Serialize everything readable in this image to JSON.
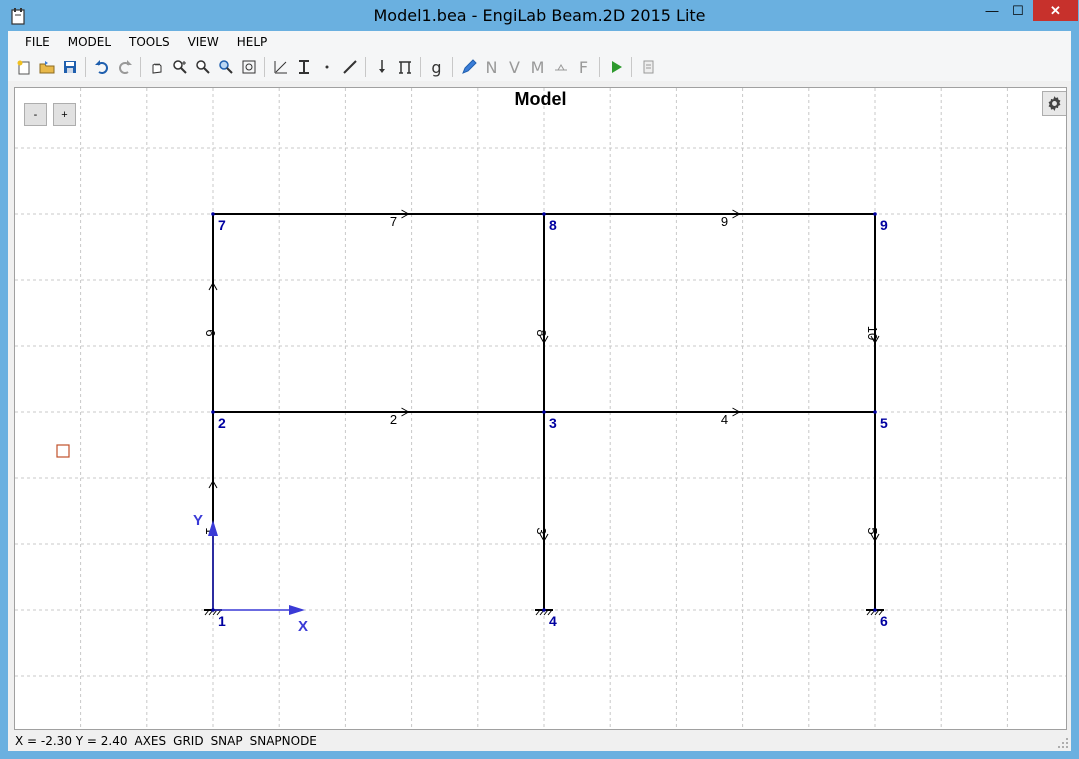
{
  "window": {
    "title": "Model1.bea - EngiLab Beam.2D 2015 Lite",
    "minimize_glyph": "—",
    "maximize_glyph": "☐",
    "close_glyph": "✕"
  },
  "menu": {
    "file": "FILE",
    "model": "MODEL",
    "tools": "TOOLS",
    "view": "VIEW",
    "help": "HELP"
  },
  "toolbar": {
    "icons": [
      "new-icon",
      "open-icon",
      "save-icon",
      "undo-icon",
      "redo-icon",
      "pan-icon",
      "zoom-in-icon",
      "zoom-window-icon",
      "zoom-extents-icon",
      "zoom-previous-icon",
      "material-icon",
      "section-icon",
      "node-icon",
      "element-icon",
      "load-icon",
      "support-icon",
      "gravity-icon",
      "edit-icon",
      "normal-force-icon",
      "shear-force-icon",
      "moment-icon",
      "deformed-icon",
      "reactions-icon",
      "run-icon",
      "report-icon"
    ],
    "gravity_label": "g",
    "n_label": "N",
    "v_label": "V",
    "m_label": "M",
    "f_label": "F"
  },
  "canvas": {
    "title": "Model",
    "zoom_out": "-",
    "zoom_in": "+",
    "axis_x": "X",
    "axis_y": "Y",
    "colors": {
      "node_label": "#0000a0",
      "axes": "#3a3ad6",
      "element": "#000000",
      "grid": "#c8c8c8",
      "marker": "#c0502a"
    }
  },
  "model": {
    "nodes": [
      {
        "id": "1",
        "x": 0,
        "y": 0
      },
      {
        "id": "2",
        "x": 0,
        "y": 3
      },
      {
        "id": "3",
        "x": 5,
        "y": 3
      },
      {
        "id": "4",
        "x": 5,
        "y": 0
      },
      {
        "id": "5",
        "x": 10,
        "y": 3
      },
      {
        "id": "6",
        "x": 10,
        "y": 0
      },
      {
        "id": "7",
        "x": 0,
        "y": 6
      },
      {
        "id": "8",
        "x": 5,
        "y": 6
      },
      {
        "id": "9",
        "x": 10,
        "y": 6
      }
    ],
    "elements": [
      {
        "id": "1",
        "from": "1",
        "to": "2"
      },
      {
        "id": "2",
        "from": "2",
        "to": "3"
      },
      {
        "id": "3",
        "from": "3",
        "to": "4"
      },
      {
        "id": "4",
        "from": "3",
        "to": "5"
      },
      {
        "id": "5",
        "from": "5",
        "to": "6"
      },
      {
        "id": "6",
        "from": "2",
        "to": "7"
      },
      {
        "id": "7",
        "from": "7",
        "to": "8"
      },
      {
        "id": "8",
        "from": "8",
        "to": "3"
      },
      {
        "id": "9",
        "from": "8",
        "to": "9"
      },
      {
        "id": "10",
        "from": "9",
        "to": "5"
      }
    ],
    "supports": [
      "1",
      "4",
      "6"
    ]
  },
  "status": {
    "coords": "X = -2.30  Y = 2.40",
    "axes": "AXES",
    "grid": "GRID",
    "snap": "SNAP",
    "snapnode": "SNAPNODE"
  }
}
